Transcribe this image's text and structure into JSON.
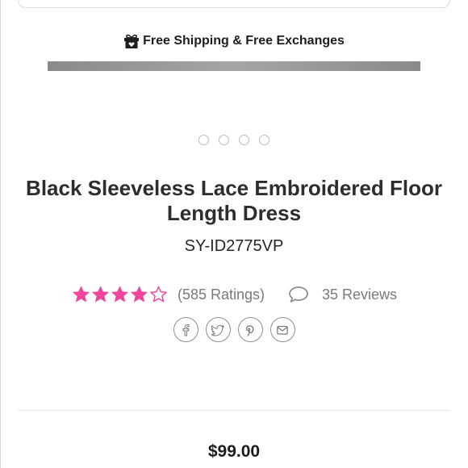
{
  "promo": {
    "text": "Free Shipping & Free Exchanges",
    "icon": "gift-box-icon"
  },
  "carousel": {
    "dot_count": 4
  },
  "product": {
    "title": "Black Sleeveless Lace Embroidered Floor Length Dress",
    "sku": "SY-ID2775VP",
    "rating": 4,
    "rating_max": 5,
    "ratings_text": "(585 Ratings)",
    "reviews_text": "35 Reviews",
    "price": "$99.00"
  },
  "share": [
    {
      "name": "facebook-icon"
    },
    {
      "name": "twitter-icon"
    },
    {
      "name": "pinterest-icon"
    },
    {
      "name": "email-icon"
    }
  ],
  "colors": {
    "star_filled": "#f0449a",
    "star_empty": "#f0449a",
    "promo_bar": "#9a9a9a",
    "icon_gray": "#8e8e8e"
  }
}
